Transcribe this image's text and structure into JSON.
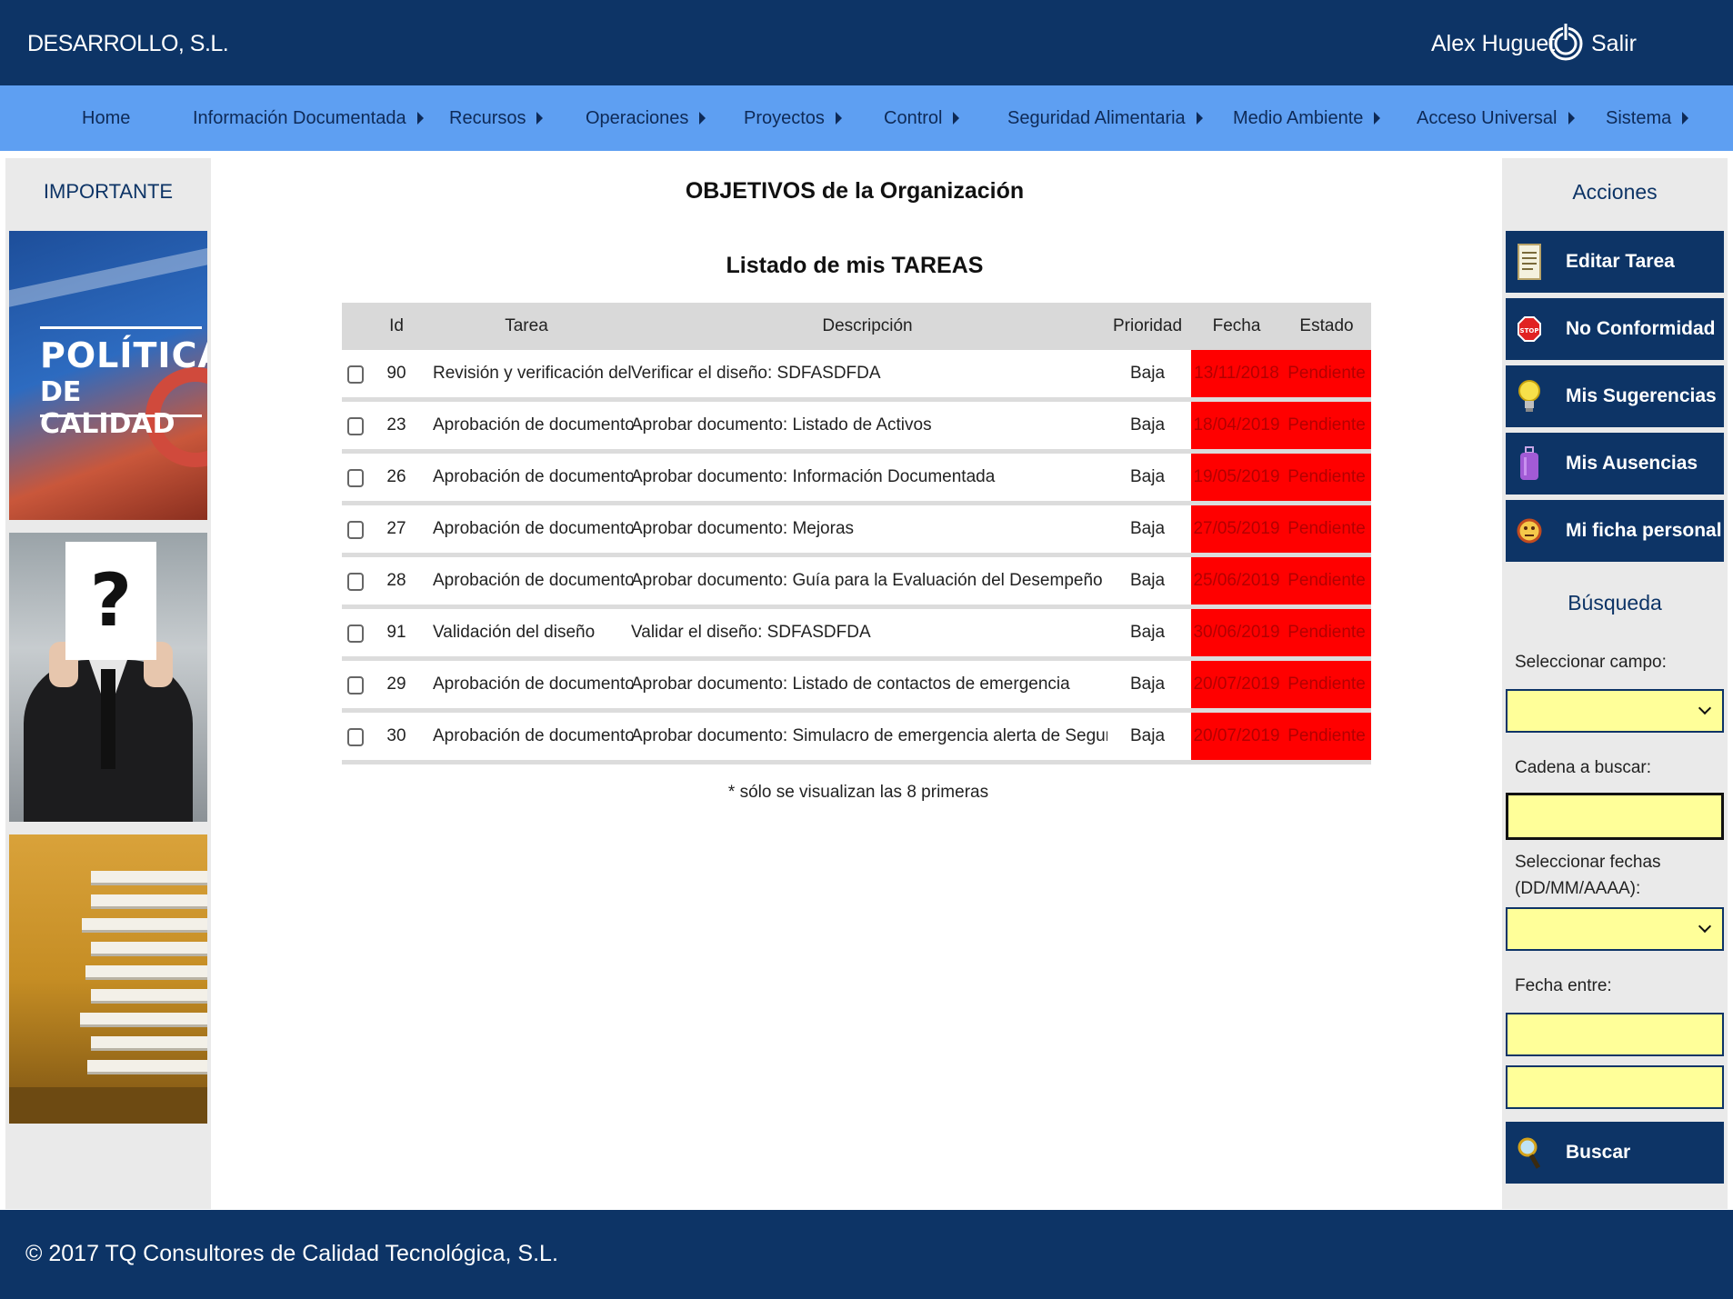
{
  "header": {
    "company": "DESARROLLO, S.L.",
    "user": "Alex Huguet",
    "logout": "Salir"
  },
  "nav": [
    {
      "label": "Home",
      "has_submenu": false
    },
    {
      "label": "Información Documentada",
      "has_submenu": true
    },
    {
      "label": "Recursos",
      "has_submenu": true
    },
    {
      "label": "Operaciones",
      "has_submenu": true
    },
    {
      "label": "Proyectos",
      "has_submenu": true
    },
    {
      "label": "Control",
      "has_submenu": true
    },
    {
      "label": "Seguridad Alimentaria",
      "has_submenu": true
    },
    {
      "label": "Medio Ambiente",
      "has_submenu": true
    },
    {
      "label": "Acceso Universal",
      "has_submenu": true
    },
    {
      "label": "Sistema",
      "has_submenu": true
    }
  ],
  "left": {
    "title": "IMPORTANTE",
    "banner_line1": "POLÍTICA",
    "banner_line2": "DE CALIDAD",
    "question_mark": "?"
  },
  "main": {
    "title": "OBJETIVOS de la Organización",
    "list_title": "Listado de mis TAREAS",
    "columns": {
      "id": "Id",
      "tarea": "Tarea",
      "descripcion": "Descripción",
      "prioridad": "Prioridad",
      "fecha": "Fecha",
      "estado": "Estado"
    },
    "rows": [
      {
        "id": "90",
        "tarea": "Revisión y verificación del diseño",
        "descripcion": "Verificar el diseño: SDFASDFDA",
        "prioridad": "Baja",
        "fecha": "13/11/2018",
        "estado": "Pendiente"
      },
      {
        "id": "23",
        "tarea": "Aprobación de documentos",
        "descripcion": "Aprobar documento: Listado de Activos",
        "prioridad": "Baja",
        "fecha": "18/04/2019",
        "estado": "Pendiente"
      },
      {
        "id": "26",
        "tarea": "Aprobación de documentos",
        "descripcion": "Aprobar documento: Información Documentada",
        "prioridad": "Baja",
        "fecha": "19/05/2019",
        "estado": "Pendiente"
      },
      {
        "id": "27",
        "tarea": "Aprobación de documentos",
        "descripcion": "Aprobar documento: Mejoras",
        "prioridad": "Baja",
        "fecha": "27/05/2019",
        "estado": "Pendiente"
      },
      {
        "id": "28",
        "tarea": "Aprobación de documentos",
        "descripcion": "Aprobar documento: Guía para la Evaluación del Desempeño",
        "prioridad": "Baja",
        "fecha": "25/06/2019",
        "estado": "Pendiente"
      },
      {
        "id": "91",
        "tarea": "Validación del diseño",
        "descripcion": "Validar el diseño: SDFASDFDA",
        "prioridad": "Baja",
        "fecha": "30/06/2019",
        "estado": "Pendiente"
      },
      {
        "id": "29",
        "tarea": "Aprobación de documentos",
        "descripcion": "Aprobar documento: Listado de contactos de emergencia",
        "prioridad": "Baja",
        "fecha": "20/07/2019",
        "estado": "Pendiente"
      },
      {
        "id": "30",
        "tarea": "Aprobación de documentos",
        "descripcion": "Aprobar documento: Simulacro de emergencia alerta de Seguridad Alimentaria",
        "prioridad": "Baja",
        "fecha": "20/07/2019",
        "estado": "Pendiente"
      }
    ],
    "note": "* sólo se visualizan las 8 primeras"
  },
  "right": {
    "actions_title": "Acciones",
    "actions": [
      {
        "label": "Editar Tarea",
        "icon": "document-icon"
      },
      {
        "label": "No Conformidad",
        "icon": "stop-icon"
      },
      {
        "label": "Mis Sugerencias",
        "icon": "lightbulb-icon"
      },
      {
        "label": "Mis Ausencias",
        "icon": "suitcase-icon"
      },
      {
        "label": "Mi ficha personal",
        "icon": "face-icon"
      }
    ],
    "search_title": "Búsqueda",
    "field_label": "Seleccionar campo:",
    "field_value": "",
    "string_label": "Cadena a buscar:",
    "string_value": "",
    "dates_label_1": "Seleccionar fechas",
    "dates_label_2": "(DD/MM/AAAA):",
    "dates_value": "",
    "between_label": "Fecha entre:",
    "date_from": "",
    "date_to": "",
    "search_button": "Buscar"
  },
  "footer": {
    "text": "© 2017 TQ Consultores de Calidad Tecnológica, S.L."
  },
  "colors": {
    "dark_blue": "#0d3466",
    "nav_blue": "#5e9ff2",
    "alert_red": "#ff0000",
    "input_yellow": "#ffff99"
  }
}
